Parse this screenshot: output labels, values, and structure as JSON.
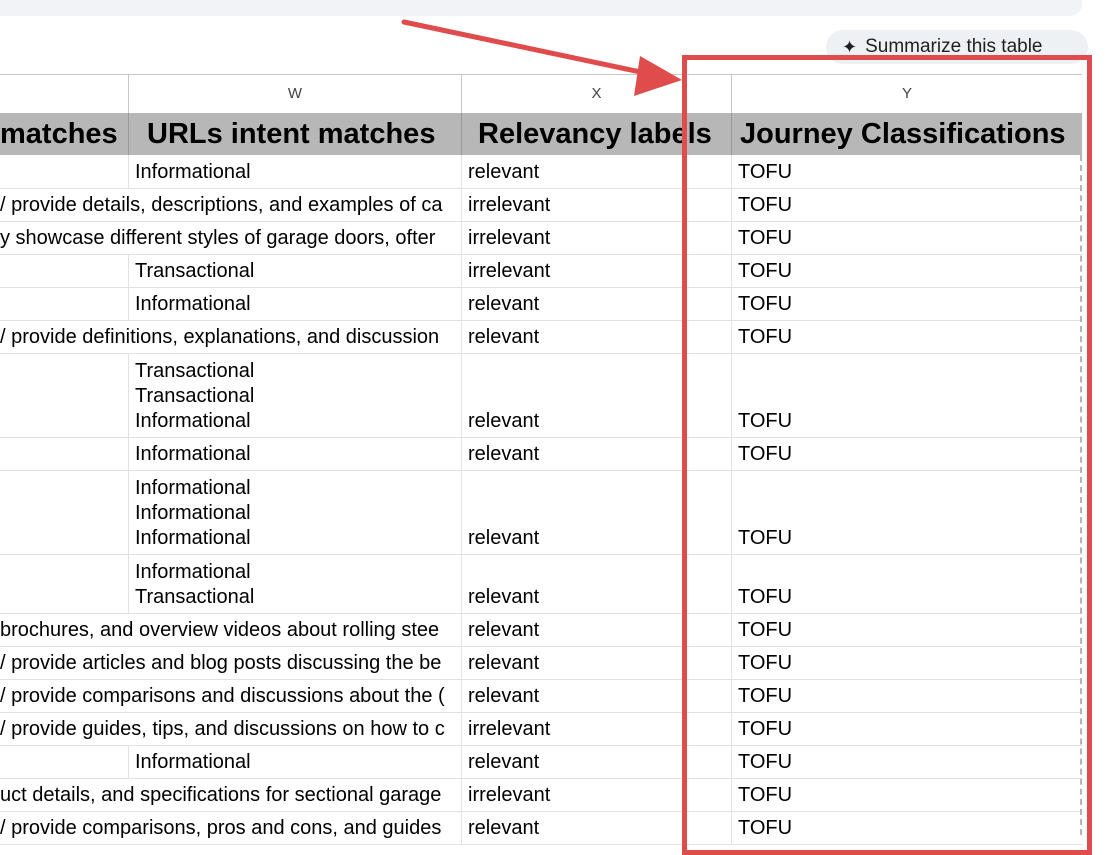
{
  "summarize": {
    "label": "Summarize this table",
    "icon": "sparkle-icon"
  },
  "columns": {
    "letters": [
      "W",
      "X",
      "Y"
    ],
    "headers": [
      "matches",
      "URLs intent matches",
      "Relevancy labels",
      "Journey Classifications"
    ]
  },
  "rows": [
    {
      "c0": "",
      "w": [
        "Informational"
      ],
      "x": "relevant",
      "y": "TOFU"
    },
    {
      "c0": "/ provide details, descriptions, and examples of ca",
      "w": [],
      "x": "irrelevant",
      "y": "TOFU"
    },
    {
      "c0": "y showcase different styles of garage doors, ofter",
      "w": [],
      "x": "irrelevant",
      "y": "TOFU"
    },
    {
      "c0": "",
      "w": [
        "Transactional"
      ],
      "x": "irrelevant",
      "y": "TOFU"
    },
    {
      "c0": "",
      "w": [
        "Informational"
      ],
      "x": "relevant",
      "y": "TOFU"
    },
    {
      "c0": "/ provide definitions, explanations, and discussion",
      "w": [],
      "x": "relevant",
      "y": "TOFU"
    },
    {
      "c0": "",
      "w": [
        "Transactional",
        "Transactional",
        "Informational"
      ],
      "x": "relevant",
      "y": "TOFU"
    },
    {
      "c0": "",
      "w": [
        "Informational"
      ],
      "x": "relevant",
      "y": "TOFU"
    },
    {
      "c0": "",
      "w": [
        "Informational",
        "Informational",
        "Informational"
      ],
      "x": "relevant",
      "y": "TOFU"
    },
    {
      "c0": "",
      "w": [
        "Informational",
        "Transactional"
      ],
      "x": "relevant",
      "y": "TOFU"
    },
    {
      "c0": "brochures, and overview videos about rolling stee",
      "w": [],
      "x": "relevant",
      "y": "TOFU"
    },
    {
      "c0": "/ provide articles and blog posts discussing the be",
      "w": [],
      "x": "relevant",
      "y": "TOFU"
    },
    {
      "c0": "/ provide comparisons and discussions about the (",
      "w": [],
      "x": "relevant",
      "y": "TOFU"
    },
    {
      "c0": "/ provide guides, tips, and discussions on how to c",
      "w": [],
      "x": "irrelevant",
      "y": "TOFU"
    },
    {
      "c0": "",
      "w": [
        "Informational"
      ],
      "x": "relevant",
      "y": "TOFU"
    },
    {
      "c0": "uct details, and specifications for sectional garage",
      "w": [],
      "x": "irrelevant",
      "y": "TOFU"
    },
    {
      "c0": "/ provide comparisons, pros and cons, and guides",
      "w": [],
      "x": "relevant",
      "y": "TOFU"
    }
  ],
  "colors": {
    "highlight": "#e04b4b",
    "header_bg": "#b7b7b7"
  }
}
